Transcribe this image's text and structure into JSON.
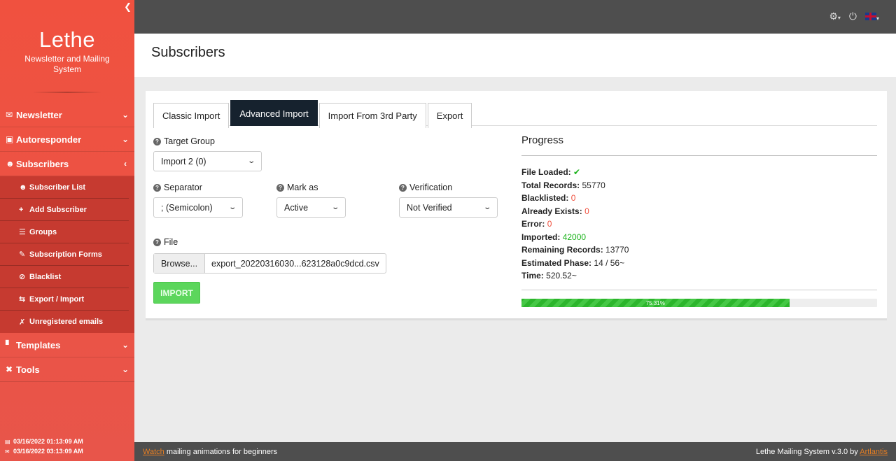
{
  "sidebar": {
    "brand_title": "Lethe",
    "brand_subtitle": "Newsletter and Mailing System",
    "items": [
      {
        "label": "Newsletter",
        "icon": "envelope-icon"
      },
      {
        "label": "Autoresponder",
        "icon": "robot-icon"
      },
      {
        "label": "Subscribers",
        "icon": "users-icon"
      },
      {
        "label": "Templates",
        "icon": "paint-roller-icon"
      },
      {
        "label": "Tools",
        "icon": "tools-icon"
      }
    ],
    "sub_items": [
      {
        "label": "Subscriber List",
        "icon": "users-icon"
      },
      {
        "label": "Add Subscriber",
        "icon": "plus-icon"
      },
      {
        "label": "Groups",
        "icon": "list-icon"
      },
      {
        "label": "Subscription Forms",
        "icon": "edit-icon"
      },
      {
        "label": "Blacklist",
        "icon": "ban-icon"
      },
      {
        "label": "Export / Import",
        "icon": "exchange-icon"
      },
      {
        "label": "Unregistered emails",
        "icon": "user-slash-icon"
      }
    ],
    "clock_server": "03/16/2022 01:13:09 AM",
    "clock_local": "03/16/2022 03:13:09 AM"
  },
  "header": {
    "title": "Subscribers"
  },
  "tabs": [
    "Classic Import",
    "Advanced Import",
    "Import From 3rd Party",
    "Export"
  ],
  "form": {
    "target_group_label": "Target Group",
    "target_group_value": "Import 2 (0)",
    "separator_label": "Separator",
    "separator_value": "; (Semicolon)",
    "mark_as_label": "Mark as",
    "mark_as_value": "Active",
    "verification_label": "Verification",
    "verification_value": "Not Verified",
    "file_label": "File",
    "browse_label": "Browse...",
    "file_name": "export_20220316030...623128a0c9dcd.csv",
    "import_button": "IMPORT"
  },
  "progress": {
    "title": "Progress",
    "file_loaded_label": "File Loaded:",
    "total_records_label": "Total Records:",
    "total_records": "55770",
    "blacklisted_label": "Blacklisted:",
    "blacklisted": "0",
    "already_exists_label": "Already Exists:",
    "already_exists": "0",
    "error_label": "Error:",
    "error": "0",
    "imported_label": "Imported:",
    "imported": "42000",
    "remaining_label": "Remaining Records:",
    "remaining": "13770",
    "phase_label": "Estimated Phase:",
    "phase": "14 / 56~",
    "time_label": "Time:",
    "time": "520.52~",
    "percent_text": "75.31%",
    "percent": 75.31
  },
  "footer": {
    "watch_link": "Watch",
    "watch_text": " mailing animations for beginners",
    "right_text": "Lethe Mailing System v.3.0 by ",
    "right_link": "Artlantis"
  },
  "colors": {
    "sidebar": "#f0513f",
    "topbar": "#4e4e4e",
    "active_tab": "#16222e",
    "success": "#1ab31a",
    "danger": "#f0513f"
  }
}
